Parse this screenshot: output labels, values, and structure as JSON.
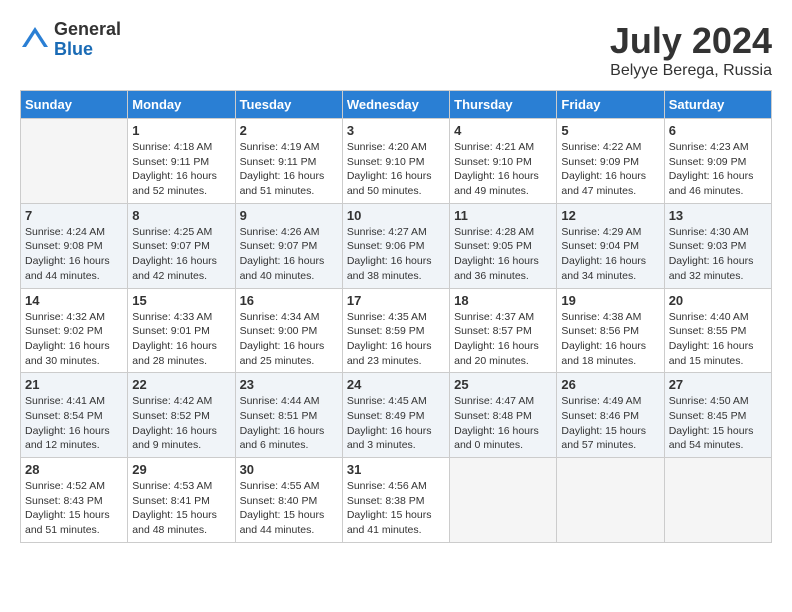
{
  "header": {
    "logo_general": "General",
    "logo_blue": "Blue",
    "month_title": "July 2024",
    "location": "Belyye Berega, Russia"
  },
  "weekdays": [
    "Sunday",
    "Monday",
    "Tuesday",
    "Wednesday",
    "Thursday",
    "Friday",
    "Saturday"
  ],
  "weeks": [
    [
      {
        "day": "",
        "info": ""
      },
      {
        "day": "1",
        "info": "Sunrise: 4:18 AM\nSunset: 9:11 PM\nDaylight: 16 hours\nand 52 minutes."
      },
      {
        "day": "2",
        "info": "Sunrise: 4:19 AM\nSunset: 9:11 PM\nDaylight: 16 hours\nand 51 minutes."
      },
      {
        "day": "3",
        "info": "Sunrise: 4:20 AM\nSunset: 9:10 PM\nDaylight: 16 hours\nand 50 minutes."
      },
      {
        "day": "4",
        "info": "Sunrise: 4:21 AM\nSunset: 9:10 PM\nDaylight: 16 hours\nand 49 minutes."
      },
      {
        "day": "5",
        "info": "Sunrise: 4:22 AM\nSunset: 9:09 PM\nDaylight: 16 hours\nand 47 minutes."
      },
      {
        "day": "6",
        "info": "Sunrise: 4:23 AM\nSunset: 9:09 PM\nDaylight: 16 hours\nand 46 minutes."
      }
    ],
    [
      {
        "day": "7",
        "info": "Sunrise: 4:24 AM\nSunset: 9:08 PM\nDaylight: 16 hours\nand 44 minutes."
      },
      {
        "day": "8",
        "info": "Sunrise: 4:25 AM\nSunset: 9:07 PM\nDaylight: 16 hours\nand 42 minutes."
      },
      {
        "day": "9",
        "info": "Sunrise: 4:26 AM\nSunset: 9:07 PM\nDaylight: 16 hours\nand 40 minutes."
      },
      {
        "day": "10",
        "info": "Sunrise: 4:27 AM\nSunset: 9:06 PM\nDaylight: 16 hours\nand 38 minutes."
      },
      {
        "day": "11",
        "info": "Sunrise: 4:28 AM\nSunset: 9:05 PM\nDaylight: 16 hours\nand 36 minutes."
      },
      {
        "day": "12",
        "info": "Sunrise: 4:29 AM\nSunset: 9:04 PM\nDaylight: 16 hours\nand 34 minutes."
      },
      {
        "day": "13",
        "info": "Sunrise: 4:30 AM\nSunset: 9:03 PM\nDaylight: 16 hours\nand 32 minutes."
      }
    ],
    [
      {
        "day": "14",
        "info": "Sunrise: 4:32 AM\nSunset: 9:02 PM\nDaylight: 16 hours\nand 30 minutes."
      },
      {
        "day": "15",
        "info": "Sunrise: 4:33 AM\nSunset: 9:01 PM\nDaylight: 16 hours\nand 28 minutes."
      },
      {
        "day": "16",
        "info": "Sunrise: 4:34 AM\nSunset: 9:00 PM\nDaylight: 16 hours\nand 25 minutes."
      },
      {
        "day": "17",
        "info": "Sunrise: 4:35 AM\nSunset: 8:59 PM\nDaylight: 16 hours\nand 23 minutes."
      },
      {
        "day": "18",
        "info": "Sunrise: 4:37 AM\nSunset: 8:57 PM\nDaylight: 16 hours\nand 20 minutes."
      },
      {
        "day": "19",
        "info": "Sunrise: 4:38 AM\nSunset: 8:56 PM\nDaylight: 16 hours\nand 18 minutes."
      },
      {
        "day": "20",
        "info": "Sunrise: 4:40 AM\nSunset: 8:55 PM\nDaylight: 16 hours\nand 15 minutes."
      }
    ],
    [
      {
        "day": "21",
        "info": "Sunrise: 4:41 AM\nSunset: 8:54 PM\nDaylight: 16 hours\nand 12 minutes."
      },
      {
        "day": "22",
        "info": "Sunrise: 4:42 AM\nSunset: 8:52 PM\nDaylight: 16 hours\nand 9 minutes."
      },
      {
        "day": "23",
        "info": "Sunrise: 4:44 AM\nSunset: 8:51 PM\nDaylight: 16 hours\nand 6 minutes."
      },
      {
        "day": "24",
        "info": "Sunrise: 4:45 AM\nSunset: 8:49 PM\nDaylight: 16 hours\nand 3 minutes."
      },
      {
        "day": "25",
        "info": "Sunrise: 4:47 AM\nSunset: 8:48 PM\nDaylight: 16 hours\nand 0 minutes."
      },
      {
        "day": "26",
        "info": "Sunrise: 4:49 AM\nSunset: 8:46 PM\nDaylight: 15 hours\nand 57 minutes."
      },
      {
        "day": "27",
        "info": "Sunrise: 4:50 AM\nSunset: 8:45 PM\nDaylight: 15 hours\nand 54 minutes."
      }
    ],
    [
      {
        "day": "28",
        "info": "Sunrise: 4:52 AM\nSunset: 8:43 PM\nDaylight: 15 hours\nand 51 minutes."
      },
      {
        "day": "29",
        "info": "Sunrise: 4:53 AM\nSunset: 8:41 PM\nDaylight: 15 hours\nand 48 minutes."
      },
      {
        "day": "30",
        "info": "Sunrise: 4:55 AM\nSunset: 8:40 PM\nDaylight: 15 hours\nand 44 minutes."
      },
      {
        "day": "31",
        "info": "Sunrise: 4:56 AM\nSunset: 8:38 PM\nDaylight: 15 hours\nand 41 minutes."
      },
      {
        "day": "",
        "info": ""
      },
      {
        "day": "",
        "info": ""
      },
      {
        "day": "",
        "info": ""
      }
    ]
  ]
}
